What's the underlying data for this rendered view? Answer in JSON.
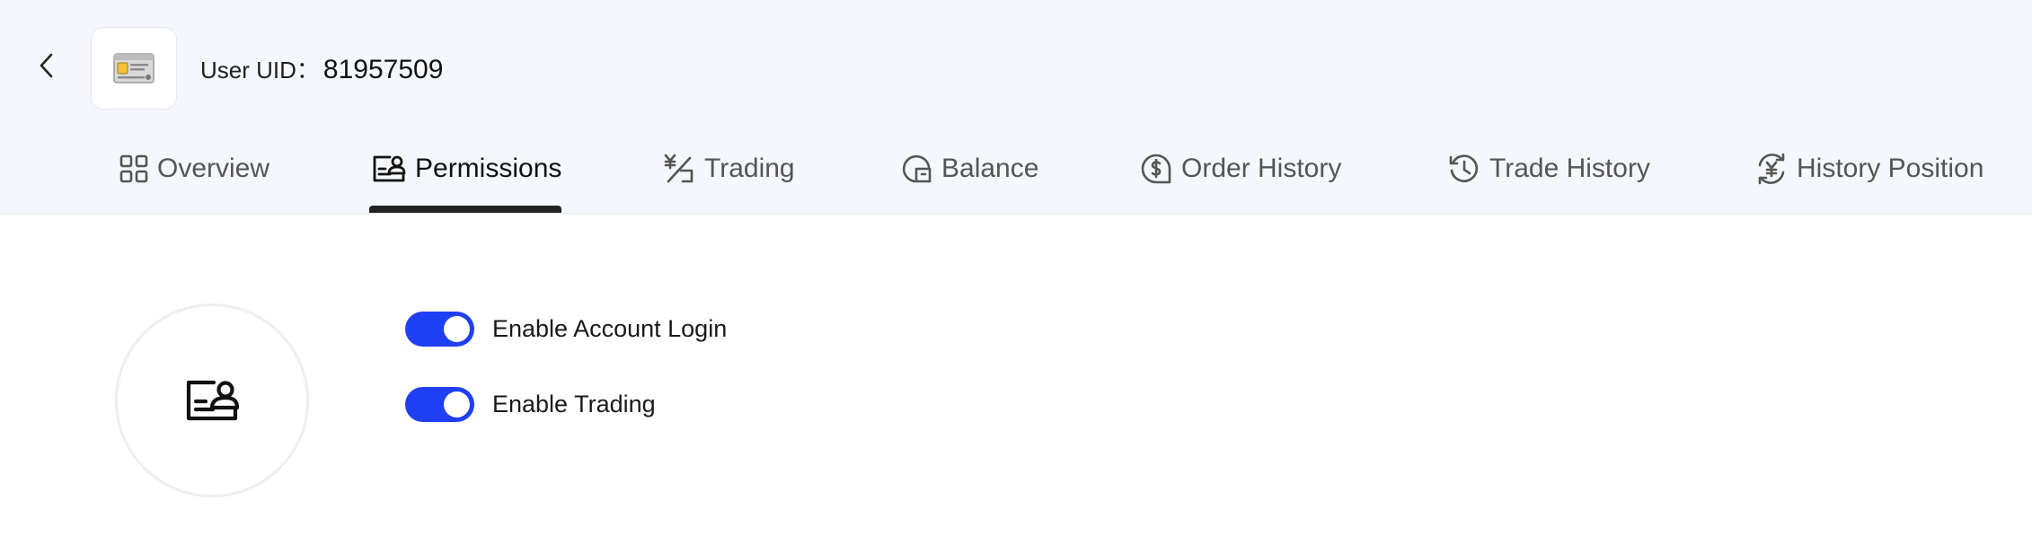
{
  "header": {
    "uid_label": "User UID：",
    "uid_value": "81957509"
  },
  "tabs": [
    {
      "label": "Overview",
      "icon": "grid-icon",
      "active": false
    },
    {
      "label": "Permissions",
      "icon": "user-card-icon",
      "active": true
    },
    {
      "label": "Trading",
      "icon": "yen-trade-icon",
      "active": false
    },
    {
      "label": "Balance",
      "icon": "balance-icon",
      "active": false
    },
    {
      "label": "Order History",
      "icon": "dollar-bubble-icon",
      "active": false
    },
    {
      "label": "Trade History",
      "icon": "history-clock-icon",
      "active": false
    },
    {
      "label": "History Position",
      "icon": "yen-cycle-icon",
      "active": false
    }
  ],
  "permissions": {
    "icon": "user-card-icon",
    "toggles": [
      {
        "label": "Enable Account Login",
        "enabled": true
      },
      {
        "label": "Enable Trading",
        "enabled": true
      }
    ]
  },
  "colors": {
    "accent": "#1f3ff5",
    "header_bg": "#f4f7fb",
    "active_indicator": "#232323"
  }
}
